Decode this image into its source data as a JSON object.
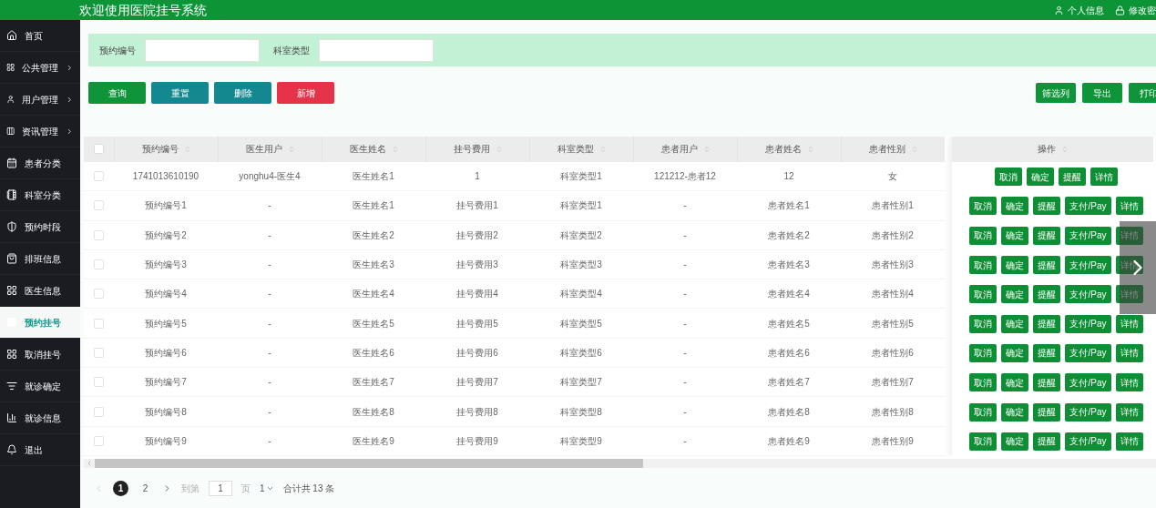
{
  "header": {
    "title": "欢迎使用医院挂号系统",
    "links": [
      "个人信息",
      "修改密"
    ]
  },
  "sidebar": {
    "items": [
      {
        "label": "首页",
        "expandable": false,
        "selected": false
      },
      {
        "label": "公共管理",
        "expandable": true,
        "selected": false
      },
      {
        "label": "用户管理",
        "expandable": true,
        "selected": false
      },
      {
        "label": "资讯管理",
        "expandable": true,
        "selected": false
      },
      {
        "label": "患者分类",
        "expandable": false,
        "selected": false
      },
      {
        "label": "科室分类",
        "expandable": false,
        "selected": false
      },
      {
        "label": "预约时段",
        "expandable": false,
        "selected": false
      },
      {
        "label": "排班信息",
        "expandable": false,
        "selected": false
      },
      {
        "label": "医生信息",
        "expandable": false,
        "selected": false
      },
      {
        "label": "预约挂号",
        "expandable": false,
        "selected": true
      },
      {
        "label": "取消挂号",
        "expandable": false,
        "selected": false
      },
      {
        "label": "就诊确定",
        "expandable": false,
        "selected": false
      },
      {
        "label": "就诊信息",
        "expandable": false,
        "selected": false
      },
      {
        "label": "退出",
        "expandable": false,
        "selected": false
      }
    ]
  },
  "search": {
    "fields": [
      {
        "label": "预约编号"
      },
      {
        "label": "科室类型"
      }
    ]
  },
  "toolbar": {
    "left": [
      {
        "label": "查询",
        "kind": "primary"
      },
      {
        "label": "重置",
        "kind": "secondary"
      },
      {
        "label": "删除",
        "kind": "secondary"
      },
      {
        "label": "新增",
        "kind": "danger"
      }
    ],
    "right": [
      "筛选列",
      "导出",
      "打印"
    ]
  },
  "table": {
    "header_checked": false,
    "columns": [
      "预约编号",
      "医生用户",
      "医生姓名",
      "挂号费用",
      "科室类型",
      "患者用户",
      "患者姓名",
      "患者性别"
    ],
    "action_column": "操作",
    "rows": [
      {
        "checked": false,
        "cells": [
          "1741013610190",
          "yonghu4-医生4",
          "医生姓名1",
          "1",
          "科室类型1",
          "121212-患者12",
          "12",
          "女"
        ],
        "actions": [
          "取消",
          "确定",
          "提醒",
          "详情"
        ]
      },
      {
        "checked": false,
        "cells": [
          "预约编号1",
          "-",
          "医生姓名1",
          "挂号费用1",
          "科室类型1",
          "-",
          "患者姓名1",
          "患者性别1"
        ],
        "actions": [
          "取消",
          "确定",
          "提醒",
          "支付/Pay",
          "详情"
        ]
      },
      {
        "checked": false,
        "cells": [
          "预约编号2",
          "-",
          "医生姓名2",
          "挂号费用2",
          "科室类型2",
          "-",
          "患者姓名2",
          "患者性别2"
        ],
        "actions": [
          "取消",
          "确定",
          "提醒",
          "支付/Pay",
          "详情"
        ]
      },
      {
        "checked": false,
        "cells": [
          "预约编号3",
          "-",
          "医生姓名3",
          "挂号费用3",
          "科室类型3",
          "-",
          "患者姓名3",
          "患者性别3"
        ],
        "actions": [
          "取消",
          "确定",
          "提醒",
          "支付/Pay",
          "详情"
        ]
      },
      {
        "checked": false,
        "cells": [
          "预约编号4",
          "-",
          "医生姓名4",
          "挂号费用4",
          "科室类型4",
          "-",
          "患者姓名4",
          "患者性别4"
        ],
        "actions": [
          "取消",
          "确定",
          "提醒",
          "支付/Pay",
          "详情"
        ]
      },
      {
        "checked": false,
        "cells": [
          "预约编号5",
          "-",
          "医生姓名5",
          "挂号费用5",
          "科室类型5",
          "-",
          "患者姓名5",
          "患者性别5"
        ],
        "actions": [
          "取消",
          "确定",
          "提醒",
          "支付/Pay",
          "详情"
        ]
      },
      {
        "checked": false,
        "cells": [
          "预约编号6",
          "-",
          "医生姓名6",
          "挂号费用6",
          "科室类型6",
          "-",
          "患者姓名6",
          "患者性别6"
        ],
        "actions": [
          "取消",
          "确定",
          "提醒",
          "支付/Pay",
          "详情"
        ]
      },
      {
        "checked": false,
        "cells": [
          "预约编号7",
          "-",
          "医生姓名7",
          "挂号费用7",
          "科室类型7",
          "-",
          "患者姓名7",
          "患者性别7"
        ],
        "actions": [
          "取消",
          "确定",
          "提醒",
          "支付/Pay",
          "详情"
        ]
      },
      {
        "checked": false,
        "cells": [
          "预约编号8",
          "-",
          "医生姓名8",
          "挂号费用8",
          "科室类型8",
          "-",
          "患者姓名8",
          "患者性别8"
        ],
        "actions": [
          "取消",
          "确定",
          "提醒",
          "支付/Pay",
          "详情"
        ]
      },
      {
        "checked": false,
        "cells": [
          "预约编号9",
          "-",
          "医生姓名9",
          "挂号费用9",
          "科室类型9",
          "-",
          "患者姓名9",
          "患者性别9"
        ],
        "actions": [
          "取消",
          "确定",
          "提醒",
          "支付/Pay",
          "详情"
        ]
      }
    ]
  },
  "pagination": {
    "pages": [
      {
        "label": "1",
        "selected": true
      },
      {
        "label": "2",
        "selected": false
      }
    ],
    "goto_label": "到第",
    "goto_value": "1",
    "page_unit": "页",
    "page_size": "1",
    "total": "合计共 13 条"
  }
}
